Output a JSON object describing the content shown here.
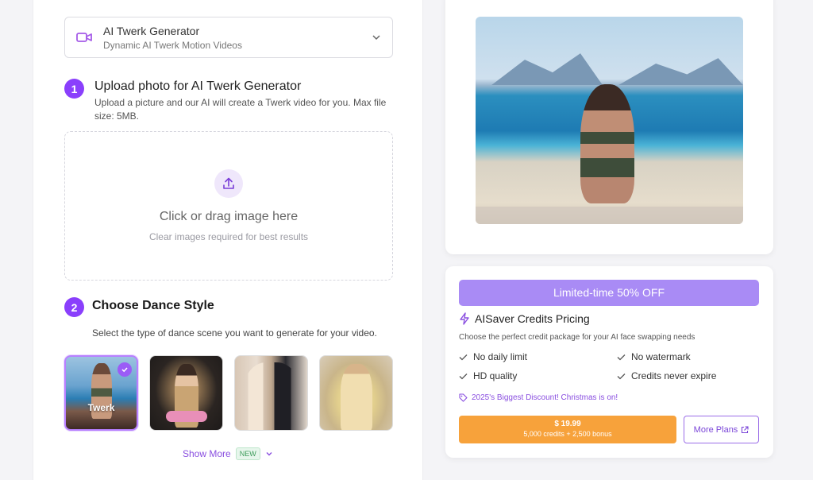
{
  "tool_selector": {
    "title": "AI Twerk Generator",
    "subtitle": "Dynamic AI Twerk Motion Videos",
    "icon": "video-camera-icon"
  },
  "step1": {
    "number": "1",
    "title": "Upload photo for AI Twerk Generator",
    "description": "Upload a picture and our AI will create a Twerk video for you. Max file size: 5MB."
  },
  "dropzone": {
    "title": "Click or drag image here",
    "subtitle": "Clear images required for best results",
    "icon": "upload-icon"
  },
  "step2": {
    "number": "2",
    "title": "Choose Dance Style",
    "description": "Select the type of dance scene you want to generate for your video."
  },
  "styles": [
    {
      "label": "Twerk",
      "selected": true
    },
    {
      "label": "",
      "selected": false
    },
    {
      "label": "",
      "selected": false
    },
    {
      "label": "",
      "selected": false
    }
  ],
  "show_more": {
    "label": "Show More",
    "badge": "NEW"
  },
  "pricing": {
    "banner": "Limited-time 50% OFF",
    "title": "AISaver Credits Pricing",
    "description": "Choose the perfect credit package for your AI face swapping needs",
    "features": [
      "No daily limit",
      "No watermark",
      "HD quality",
      "Credits never expire"
    ],
    "discount": "2025's Biggest Discount! Christmas is on!",
    "price": "$ 19.99",
    "credits": "5,000 credits + 2,500 bonus",
    "more_plans": "More Plans"
  },
  "colors": {
    "accent": "#8a3ffc",
    "banner": "#a98bf5",
    "buy": "#f7a23b"
  }
}
